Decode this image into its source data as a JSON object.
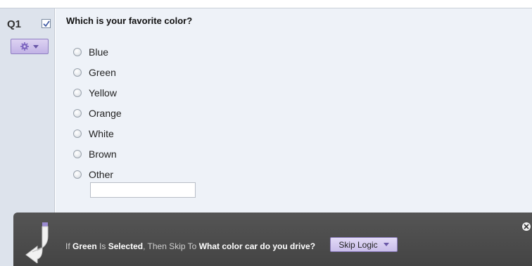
{
  "question": {
    "number": "Q1",
    "text": "Which is your favorite color?",
    "options": [
      "Blue",
      "Green",
      "Yellow",
      "Orange",
      "White",
      "Brown",
      "Other"
    ],
    "other_input_value": ""
  },
  "skip_logic": {
    "prefix": "If ",
    "choice": "Green",
    "is": " Is ",
    "condition": "Selected",
    "then": ", Then Skip To ",
    "target": "What color car do you drive?",
    "button_label": "Skip Logic"
  },
  "icons": {
    "check": "checkbox-checked-icon",
    "gear": "gear-icon",
    "dropdown": "chevron-down-icon",
    "skip_arrow": "skip-arrow-icon",
    "close": "close-icon"
  },
  "colors": {
    "accent_purple": "#c2b3e6",
    "sidebar_bg": "#dde3ec",
    "content_bg": "#eef2f8",
    "skip_bar_bg": "#4b4b4b"
  }
}
